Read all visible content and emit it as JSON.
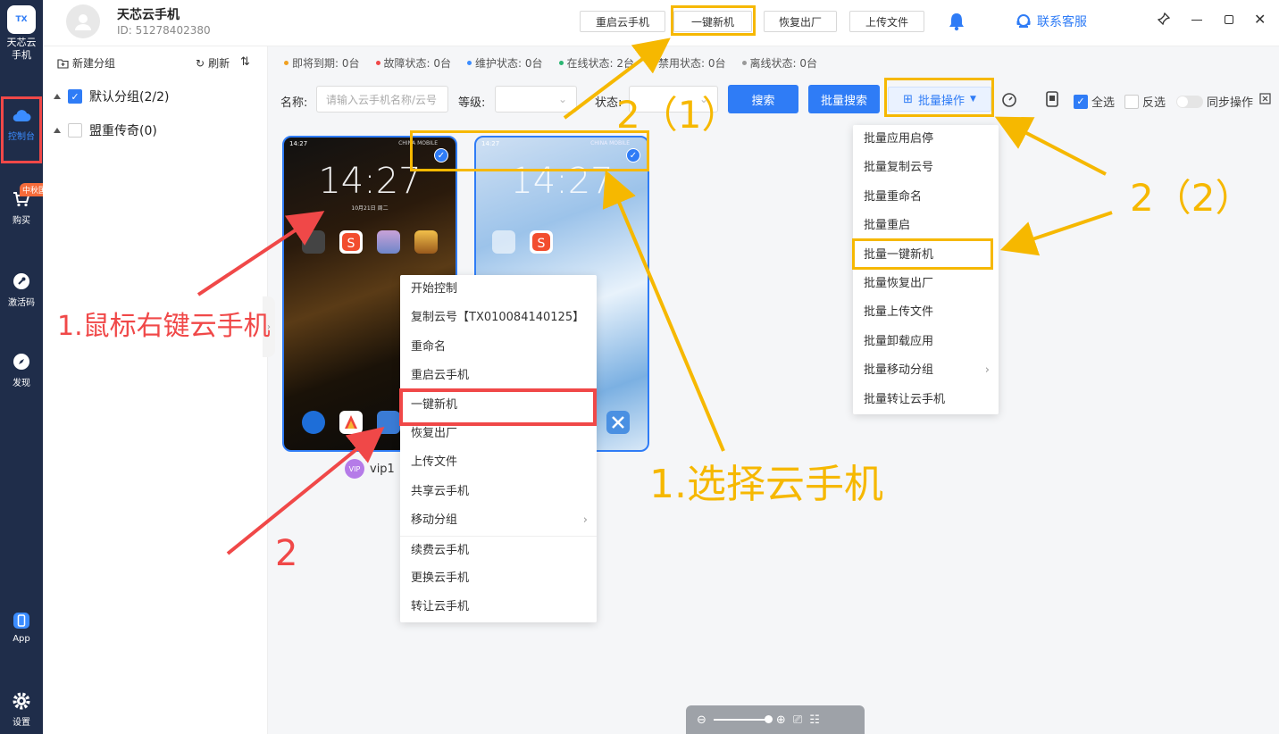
{
  "app": {
    "logo_text": "天芯云手机",
    "name": "天芯云手机",
    "id": "ID: 51278402380"
  },
  "rail": {
    "items": [
      {
        "label": "控制台",
        "icon": "cloud-icon"
      },
      {
        "label": "购买",
        "icon": "cart-icon",
        "badge": "中秋国庆"
      },
      {
        "label": "激活码",
        "icon": "key-icon"
      },
      {
        "label": "发现",
        "icon": "compass-icon"
      },
      {
        "label": "App",
        "icon": "phone-app-icon"
      },
      {
        "label": "设置",
        "icon": "gear-icon"
      }
    ]
  },
  "toolbar": {
    "restart": "重启云手机",
    "reset": "一键新机",
    "factory": "恢复出厂",
    "upload": "上传文件",
    "support": "联系客服"
  },
  "groups": {
    "new_group": "新建分组",
    "refresh": "刷新",
    "items": [
      {
        "label": "默认分组(2/2)",
        "checked": true
      },
      {
        "label": "盟重传奇(0)",
        "checked": false
      }
    ]
  },
  "status": [
    {
      "label": "即将到期: 0台",
      "color": "#f0a020"
    },
    {
      "label": "故障状态: 0台",
      "color": "#f04848"
    },
    {
      "label": "维护状态: 0台",
      "color": "#3b8cff"
    },
    {
      "label": "在线状态: 2台",
      "color": "#2bb673"
    },
    {
      "label": "禁用状态: 0台",
      "color": "#333333"
    },
    {
      "label": "离线状态: 0台",
      "color": "#999999"
    }
  ],
  "filters": {
    "name_label": "名称:",
    "name_placeholder": "请输入云手机名称/云号",
    "level_label": "等级:",
    "status_label": "状态:",
    "search": "搜索",
    "batch_search": "批量搜索",
    "batch_op": "批量操作",
    "select_all": "全选",
    "invert": "反选",
    "sync": "同步操作"
  },
  "phones": [
    {
      "time": "14:27",
      "date": "10月21日 周二",
      "carrier": "CHINA MOBILE",
      "selected": true
    },
    {
      "time": "14:27",
      "carrier": "CHINA MOBILE",
      "selected": true
    }
  ],
  "vip_label": "vip1",
  "context_menu": [
    "开始控制",
    "复制云号【TX010084140125】",
    "重命名",
    "重启云手机",
    "一键新机",
    "恢复出厂",
    "上传文件",
    "共享云手机",
    "移动分组",
    "续费云手机",
    "更换云手机",
    "转让云手机"
  ],
  "batch_menu": [
    "批量应用启停",
    "批量复制云号",
    "批量重命名",
    "批量重启",
    "批量一键新机",
    "批量恢复出厂",
    "批量上传文件",
    "批量卸载应用",
    "批量移动分组",
    "批量转让云手机"
  ],
  "annotations": {
    "right_click": "1.鼠标右键云手机",
    "step2": "2",
    "step2_1": "2（1）",
    "step2_2": "2（2）",
    "select_phone": "1.选择云手机"
  }
}
